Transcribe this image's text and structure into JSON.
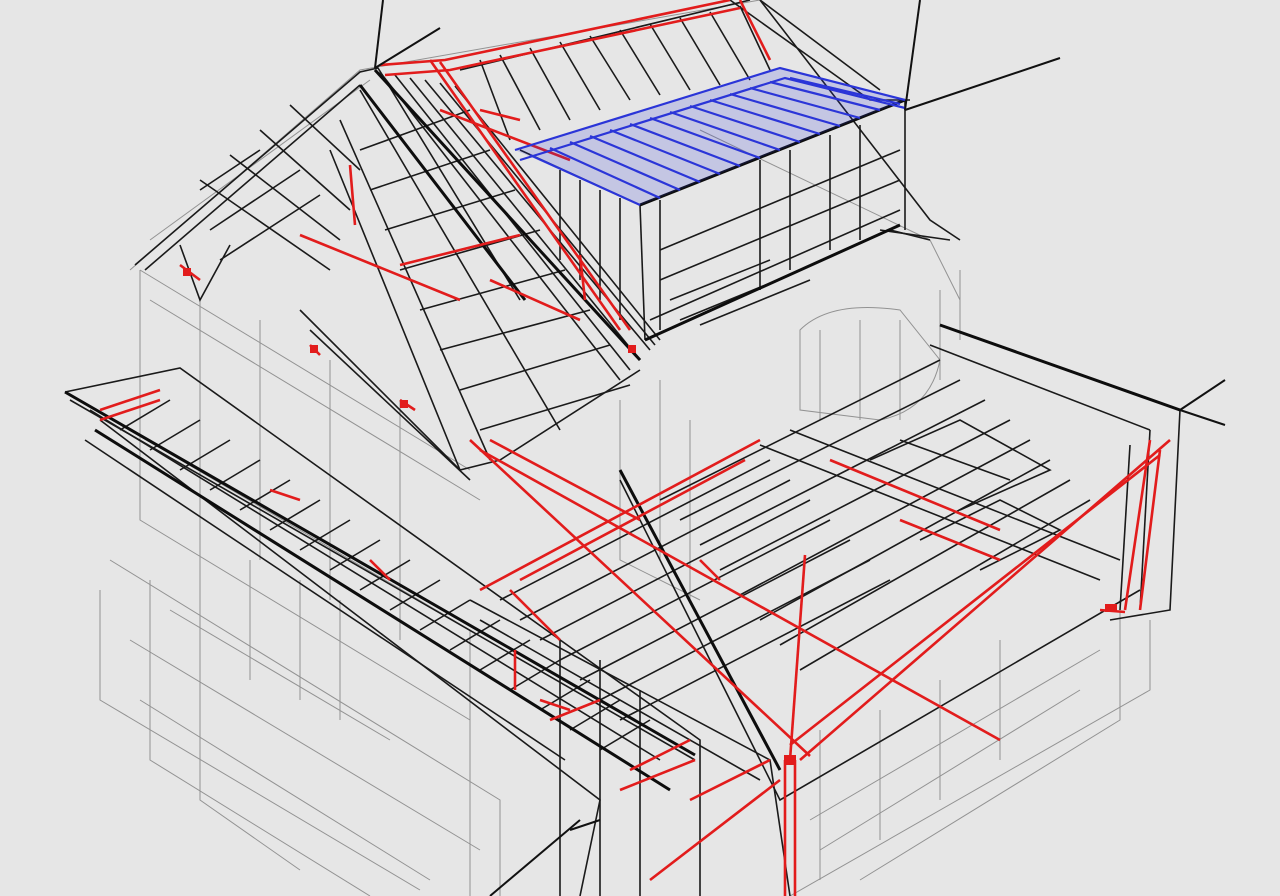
{
  "viewport": {
    "background": "#e6e6e6",
    "mode": "wireframe-xray",
    "projection": "isometric"
  },
  "legend_colors": {
    "wireframe": "#1a1a1a",
    "ghost_edges": "#777777",
    "steel_members": "#e21c1c",
    "highlighted_joists": "#2b35d8"
  },
  "model": {
    "type": "building-frame-model",
    "visible_text": []
  }
}
